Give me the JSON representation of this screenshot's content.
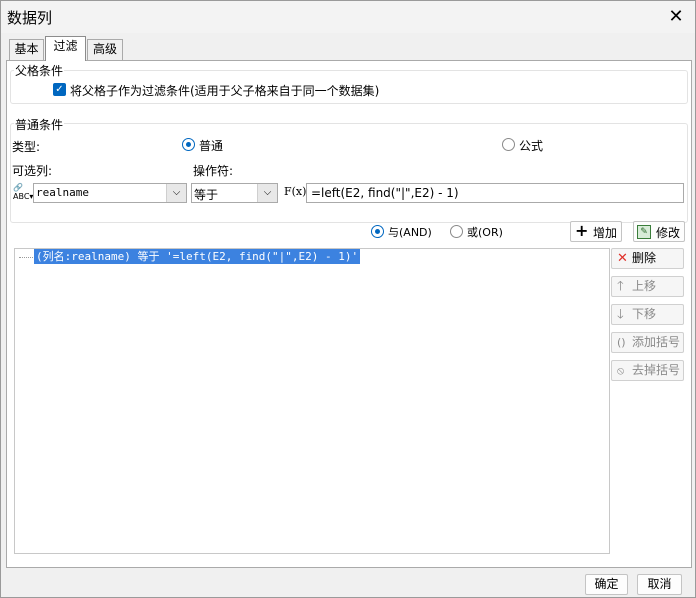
{
  "window": {
    "title": "数据列"
  },
  "tabs": [
    {
      "label": "基本",
      "active": false
    },
    {
      "label": "过滤",
      "active": true
    },
    {
      "label": "高级",
      "active": false
    }
  ],
  "parent_condition": {
    "section_title": "父格条件",
    "checkbox_label": "将父格子作为过滤条件(适用于父子格来自于同一个数据集)",
    "checked": true
  },
  "normal_condition": {
    "section_title": "普通条件",
    "type_label": "类型:",
    "type_options": [
      "普通",
      "公式"
    ],
    "type_selected": "普通",
    "column_label": "可选列:",
    "operator_label": "操作符:",
    "column_value": "realname",
    "operator_value": "等于",
    "formula_icon": "F(x)",
    "formula_value": "=left(E2, find(\"|\",E2) - 1)"
  },
  "logic": {
    "and_label": "与(AND)",
    "or_label": "或(OR)",
    "selected": "and",
    "add_label": "增加",
    "modify_label": "修改"
  },
  "conditions_list": [
    "(列名:realname) 等于 '=left(E2, find(\"|\",E2) - 1)'"
  ],
  "side_buttons": {
    "delete": "删除",
    "move_up": "上移",
    "move_down": "下移",
    "add_bracket": "添加括号",
    "remove_bracket": "去掉括号"
  },
  "footer": {
    "ok_label": "确定",
    "cancel_label": "取消"
  },
  "colors": {
    "accent": "#0067c0",
    "selection": "#3c82e0",
    "delete_red": "#e0302a"
  }
}
